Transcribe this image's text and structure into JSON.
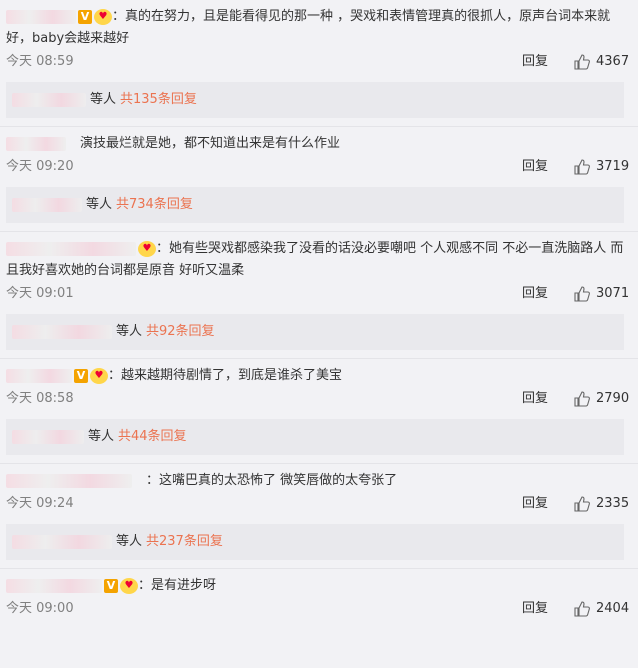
{
  "thumb_icon": "thumb-up-icon",
  "reply_label": "回复",
  "comments": [
    {
      "text": "：真的在努力，且是能看得见的那一种 ，哭戏和表情管理真的很抓人，原声台词本来就好，baby会越来越好",
      "time": "今天 08:59",
      "likes": "4367",
      "replies_prefix": "等人",
      "replies_count": "共135条回复",
      "vip": "V",
      "badge": true
    },
    {
      "text": "演技最烂就是她，都不知道出来是有什么作业",
      "time": "今天 09:20",
      "likes": "3719",
      "replies_prefix": "等人",
      "replies_count": "共734条回复",
      "vip": "",
      "badge": false
    },
    {
      "text": "：她有些哭戏都感染我了没看的话没必要嘲吧 个人观感不同 不必一直洗脑路人 而且我好喜欢她的台词都是原音 好听又温柔",
      "time": "今天 09:01",
      "likes": "3071",
      "replies_prefix": "等人",
      "replies_count": "共92条回复",
      "vip": "",
      "badge": true
    },
    {
      "text": "：越来越期待剧情了，到底是谁杀了美宝",
      "time": "今天 08:58",
      "likes": "2790",
      "replies_prefix": "等人",
      "replies_count": "共44条回复",
      "vip": "V",
      "badge": true
    },
    {
      "text": "：这嘴巴真的太恐怖了 微笑唇做的太夸张了",
      "time": "今天 09:24",
      "likes": "2335",
      "replies_prefix": "等人",
      "replies_count": "共237条回复",
      "vip": "",
      "badge": false
    },
    {
      "text": "：是有进步呀",
      "time": "今天 09:00",
      "likes": "2404",
      "vip": "V",
      "badge": true
    }
  ]
}
